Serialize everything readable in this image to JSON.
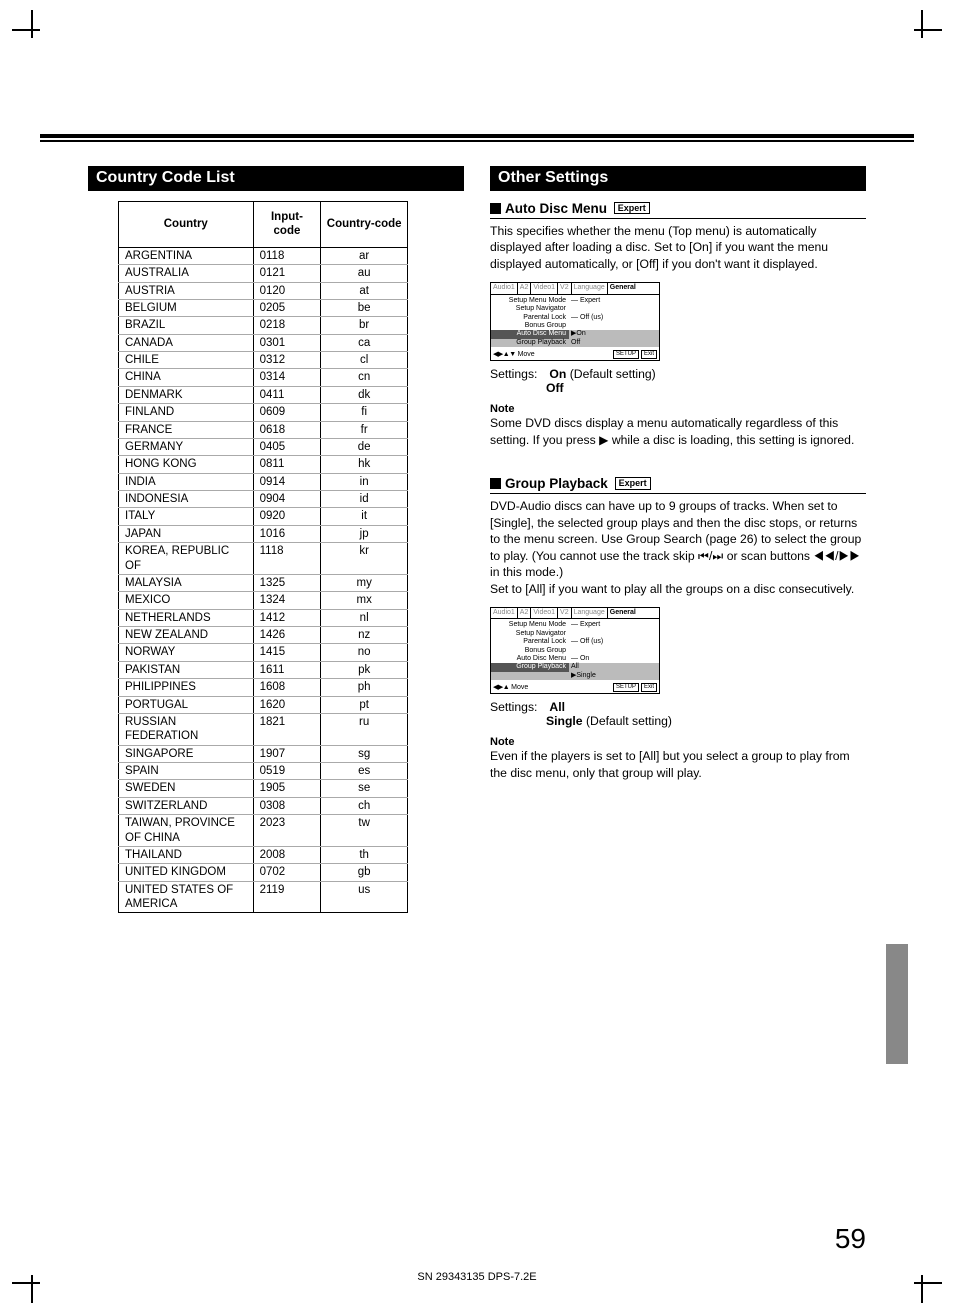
{
  "page_number": "59",
  "footer": "SN 29343135 DPS-7.2E",
  "left": {
    "section_title": "Country Code List",
    "headers": [
      "Country",
      "Input-code",
      "Country-code"
    ],
    "rows": [
      [
        "ARGENTINA",
        "0118",
        "ar"
      ],
      [
        "AUSTRALIA",
        "0121",
        "au"
      ],
      [
        "AUSTRIA",
        "0120",
        "at"
      ],
      [
        "BELGIUM",
        "0205",
        "be"
      ],
      [
        "BRAZIL",
        "0218",
        "br"
      ],
      [
        "CANADA",
        "0301",
        "ca"
      ],
      [
        "CHILE",
        "0312",
        "cl"
      ],
      [
        "CHINA",
        "0314",
        "cn"
      ],
      [
        "DENMARK",
        "0411",
        "dk"
      ],
      [
        "FINLAND",
        "0609",
        "fi"
      ],
      [
        "FRANCE",
        "0618",
        "fr"
      ],
      [
        "GERMANY",
        "0405",
        "de"
      ],
      [
        "HONG KONG",
        "0811",
        "hk"
      ],
      [
        "INDIA",
        "0914",
        "in"
      ],
      [
        "INDONESIA",
        "0904",
        "id"
      ],
      [
        "ITALY",
        "0920",
        "it"
      ],
      [
        "JAPAN",
        "1016",
        "jp"
      ],
      [
        "KOREA, REPUBLIC OF",
        "1118",
        "kr"
      ],
      [
        "MALAYSIA",
        "1325",
        "my"
      ],
      [
        "MEXICO",
        "1324",
        "mx"
      ],
      [
        "NETHERLANDS",
        "1412",
        "nl"
      ],
      [
        "NEW ZEALAND",
        "1426",
        "nz"
      ],
      [
        "NORWAY",
        "1415",
        "no"
      ],
      [
        "PAKISTAN",
        "1611",
        "pk"
      ],
      [
        "PHILIPPINES",
        "1608",
        "ph"
      ],
      [
        "PORTUGAL",
        "1620",
        "pt"
      ],
      [
        "RUSSIAN FEDERATION",
        "1821",
        "ru"
      ],
      [
        "SINGAPORE",
        "1907",
        "sg"
      ],
      [
        "SPAIN",
        "0519",
        "es"
      ],
      [
        "SWEDEN",
        "1905",
        "se"
      ],
      [
        "SWITZERLAND",
        "0308",
        "ch"
      ],
      [
        "TAIWAN, PROVINCE OF CHINA",
        "2023",
        "tw"
      ],
      [
        "THAILAND",
        "2008",
        "th"
      ],
      [
        "UNITED KINGDOM",
        "0702",
        "gb"
      ],
      [
        "UNITED STATES OF AMERICA",
        "2119",
        "us"
      ]
    ]
  },
  "right": {
    "section_title": "Other Settings",
    "expert_label": "Expert",
    "auto_disc": {
      "heading": "Auto Disc Menu",
      "paragraph": "This specifies whether the menu (Top menu) is automatically displayed after loading a disc. Set to [On] if you want the menu displayed automatically, or [Off] if you don't want it displayed.",
      "settings_label": "Settings:",
      "opt1_bold": "On",
      "opt1_rest": " (Default setting)",
      "opt2": "Off",
      "note_h": "Note",
      "note": "Some DVD discs display a menu automatically regardless of this setting. If you press ▶ while a disc is loading, this setting is ignored."
    },
    "group_playback": {
      "heading": "Group Playback",
      "paragraph": "DVD-Audio discs can have up to 9 groups of tracks. When set to [Single], the selected group plays and then the disc stops, or returns to the menu screen. Use Group Search (page 26) to select the group to play. (You cannot use the track skip ⏮/⏭ or scan buttons ◀◀/▶▶ in this mode.)\nSet to [All] if you want to play all the groups on a disc consecutively.",
      "settings_label": "Settings:",
      "opt1": "All",
      "opt2_bold": "Single",
      "opt2_rest": " (Default setting)",
      "note_h": "Note",
      "note": "Even if the players is set to [All] but you select a group to play from the disc menu, only that group will play."
    },
    "osd_common": {
      "tabs": [
        "Audio1",
        "A2",
        "Video1",
        "V2",
        "Language",
        "General"
      ],
      "move": "Move",
      "setup": "SETUP",
      "exit": "Exit"
    },
    "osd1": {
      "rows": [
        {
          "l": "Setup Menu Mode",
          "r": "— Expert",
          "hl": false
        },
        {
          "l": "Setup Navigator",
          "r": "",
          "hl": false
        },
        {
          "l": "Parental Lock",
          "r": "— Off (us)",
          "hl": false
        },
        {
          "l": "Bonus Group",
          "r": "",
          "hl": false
        },
        {
          "l": "Auto Disc Menu",
          "r": "▶On",
          "hl": true
        },
        {
          "l": "Group Playback",
          "r": "  Off",
          "hl": false,
          "grey": true
        }
      ]
    },
    "osd2": {
      "rows": [
        {
          "l": "Setup Menu Mode",
          "r": "— Expert",
          "hl": false
        },
        {
          "l": "Setup Navigator",
          "r": "",
          "hl": false
        },
        {
          "l": "Parental Lock",
          "r": "— Off (us)",
          "hl": false
        },
        {
          "l": "Bonus Group",
          "r": "",
          "hl": false
        },
        {
          "l": "Auto Disc Menu",
          "r": "— On",
          "hl": false
        },
        {
          "l": "Group Playback",
          "r": "  All",
          "hl": true
        },
        {
          "l": "",
          "r": "▶Single",
          "hl": false,
          "grey": true
        }
      ]
    }
  }
}
